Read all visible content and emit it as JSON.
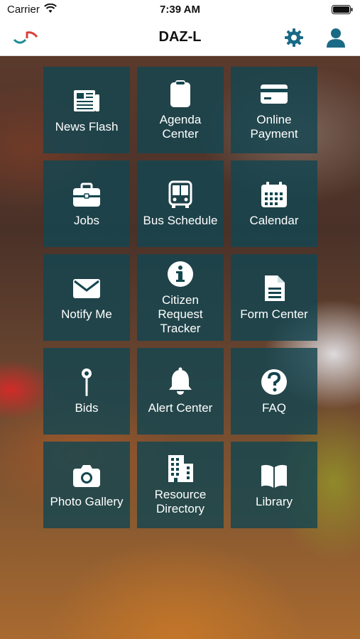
{
  "status_bar": {
    "carrier": "Carrier",
    "time": "7:39 AM"
  },
  "nav": {
    "title": "DAZ-L"
  },
  "tiles": [
    {
      "label": "News Flash",
      "icon": "newspaper-icon"
    },
    {
      "label": "Agenda\nCenter",
      "icon": "clipboard-icon"
    },
    {
      "label": "Online\nPayment",
      "icon": "credit-card-icon"
    },
    {
      "label": "Jobs",
      "icon": "briefcase-icon"
    },
    {
      "label": "Bus Schedule",
      "icon": "bus-icon"
    },
    {
      "label": "Calendar",
      "icon": "calendar-icon"
    },
    {
      "label": "Notify Me",
      "icon": "envelope-icon"
    },
    {
      "label": "Citizen\nRequest\nTracker",
      "icon": "info-icon"
    },
    {
      "label": "Form Center",
      "icon": "document-icon"
    },
    {
      "label": "Bids",
      "icon": "pin-icon"
    },
    {
      "label": "Alert Center",
      "icon": "bell-icon"
    },
    {
      "label": "FAQ",
      "icon": "question-icon"
    },
    {
      "label": "Photo Gallery",
      "icon": "camera-icon"
    },
    {
      "label": "Resource\nDirectory",
      "icon": "building-icon"
    },
    {
      "label": "Library",
      "icon": "book-icon"
    }
  ],
  "colors": {
    "accent": "#1a6a86",
    "tile": "#14464f"
  }
}
